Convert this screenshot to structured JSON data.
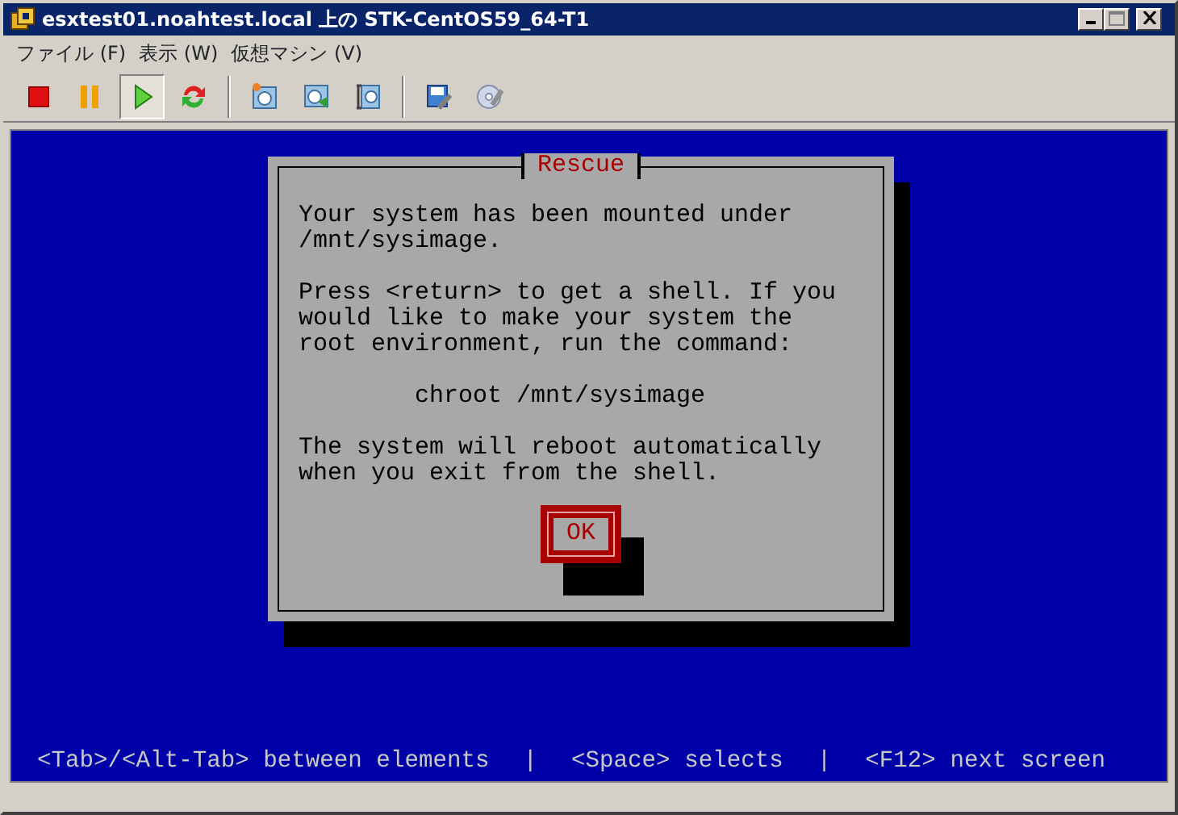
{
  "window": {
    "title": "esxtest01.noahtest.local 上の STK-CentOS59_64-T1"
  },
  "menu": [
    "ファイル (F)",
    "表示 (W)",
    "仮想マシン (V)"
  ],
  "toolbar": [
    [
      {
        "kind": "stop",
        "selected": false
      },
      {
        "kind": "pause",
        "selected": false
      },
      {
        "kind": "play",
        "selected": true
      },
      {
        "kind": "reset",
        "selected": false
      }
    ],
    [
      {
        "kind": "snapshot",
        "selected": false
      },
      {
        "kind": "revert",
        "selected": false
      },
      {
        "kind": "manager",
        "selected": false
      }
    ],
    [
      {
        "kind": "settings",
        "selected": false
      },
      {
        "kind": "media",
        "selected": false
      }
    ]
  ],
  "dialog": {
    "title": "Rescue",
    "paragraphs": [
      {
        "kind": "text",
        "lines": [
          "Your system has been mounted under",
          "/mnt/sysimage."
        ]
      },
      {
        "kind": "text",
        "lines": [
          "Press <return> to get a shell. If you",
          "would like to make your system the",
          "root environment, run the command:"
        ]
      },
      {
        "kind": "command",
        "lines": [
          "chroot /mnt/sysimage"
        ]
      },
      {
        "kind": "text",
        "lines": [
          "The system will reboot automatically",
          "when you exit from the shell."
        ]
      }
    ],
    "button": "OK"
  },
  "footer": [
    "<Tab>/<Alt-Tab> between elements",
    "|",
    "<Space> selects",
    "|",
    "<F12> next screen"
  ]
}
